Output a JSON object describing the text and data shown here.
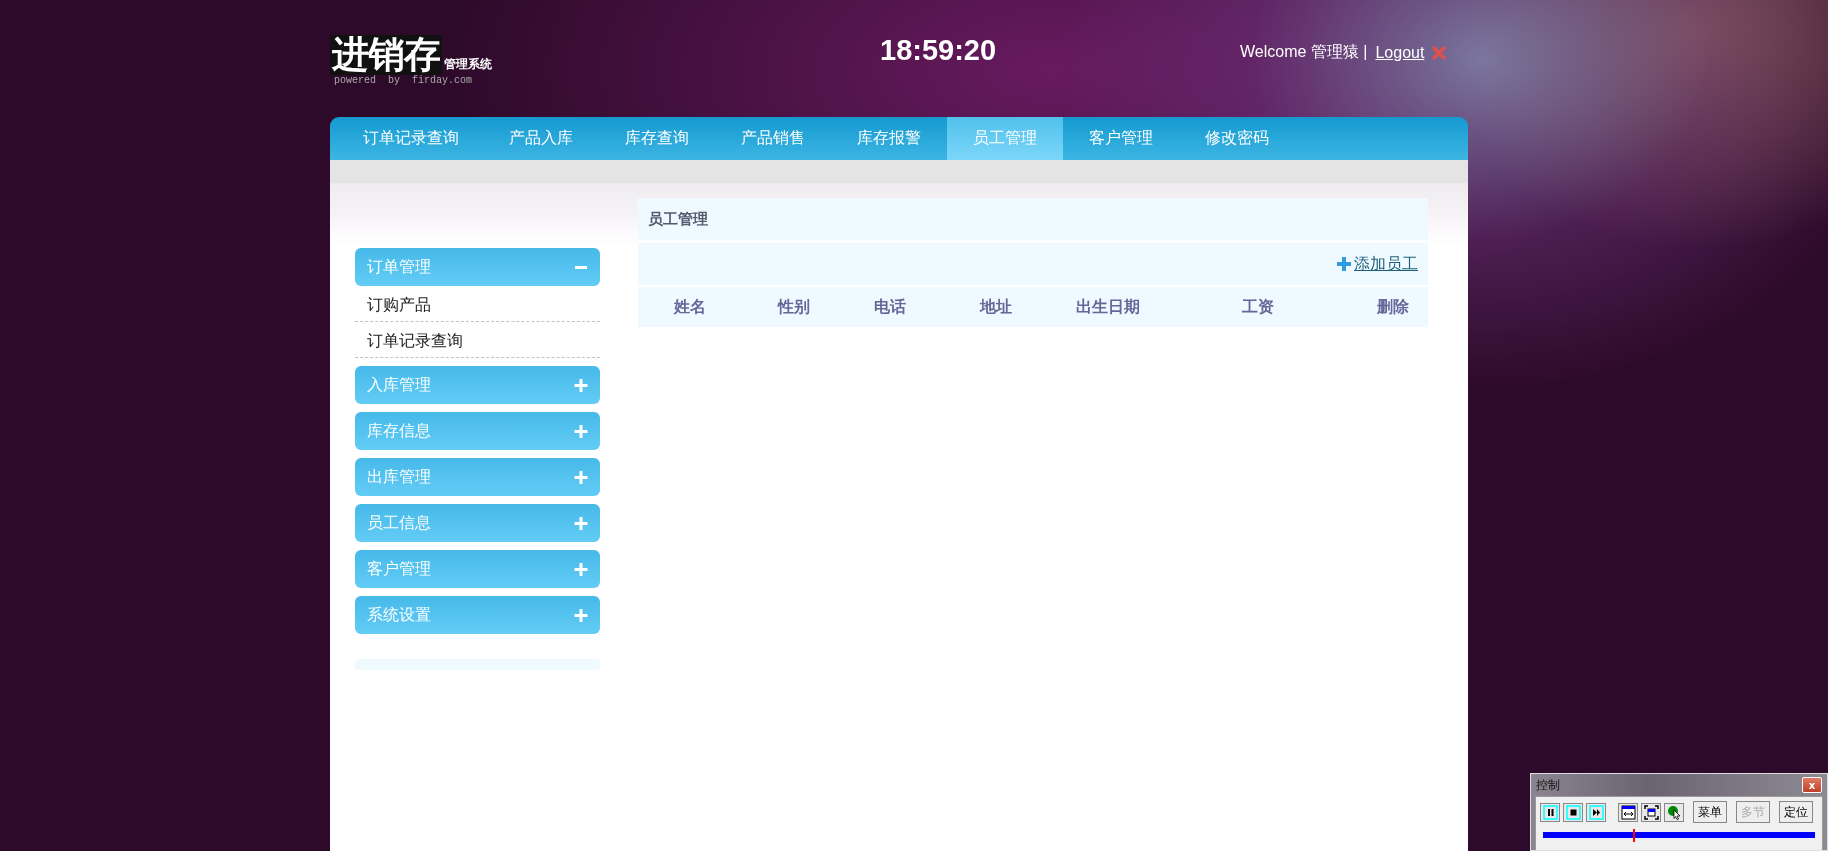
{
  "header": {
    "logo_title": "进销存",
    "logo_subtitle": "管理系统",
    "logo_powered": "powered  by  firday.com",
    "clock": "18:59:20",
    "welcome": "Welcome 管理猿 |",
    "logout": "Logout"
  },
  "nav": [
    {
      "label": "订单记录查询",
      "selected": false
    },
    {
      "label": "产品入库",
      "selected": false
    },
    {
      "label": "库存查询",
      "selected": false
    },
    {
      "label": "产品销售",
      "selected": false
    },
    {
      "label": "库存报警",
      "selected": false
    },
    {
      "label": "员工管理",
      "selected": true
    },
    {
      "label": "客户管理",
      "selected": false
    },
    {
      "label": "修改密码",
      "selected": false
    }
  ],
  "sidebar": [
    {
      "title": "订单管理",
      "expanded": true,
      "children": [
        {
          "label": "订购产品"
        },
        {
          "label": "订单记录查询"
        }
      ]
    },
    {
      "title": "入库管理",
      "expanded": false
    },
    {
      "title": "库存信息",
      "expanded": false
    },
    {
      "title": "出库管理",
      "expanded": false
    },
    {
      "title": "员工信息",
      "expanded": false
    },
    {
      "title": "客户管理",
      "expanded": false
    },
    {
      "title": "系统设置",
      "expanded": false
    }
  ],
  "content": {
    "title": "员工管理",
    "add_link": "添加员工",
    "columns": [
      "姓名",
      "性别",
      "电话",
      "地址",
      "出生日期",
      "工资",
      "删除"
    ]
  },
  "player": {
    "title": "控制",
    "close": "x",
    "buttons": [
      {
        "label": "菜单",
        "disabled": false
      },
      {
        "label": "多节",
        "disabled": true
      },
      {
        "label": "定位",
        "disabled": false
      }
    ],
    "level": 0.33
  }
}
